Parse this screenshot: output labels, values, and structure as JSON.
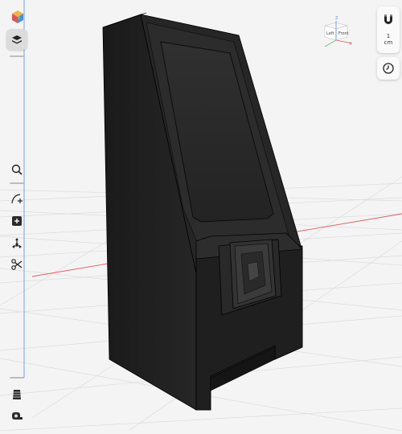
{
  "view_cube": {
    "left_label": "Left",
    "front_label": "Front",
    "axis_z": "Z",
    "axis_x": "X"
  },
  "units": {
    "value": "1",
    "unit": "cm"
  },
  "icons": {
    "app": "color-cube-icon",
    "layers": "layers-icon",
    "search": "magnifier-icon",
    "sketch": "sketch-curve-plus-icon",
    "add": "add-plus-icon",
    "transform": "transform-icon",
    "tools": "scissors-tools-icon",
    "snap": "magnet-icon",
    "history": "clock-icon",
    "mesh": "striped-mesh-icon",
    "measure": "tape-measure-icon"
  },
  "colors": {
    "background": "#f4f4f4",
    "grid": "#d9d9d9",
    "axis_x": "#e35b5b",
    "axis_y": "#5b8de3",
    "model": "#1b1b1b"
  }
}
